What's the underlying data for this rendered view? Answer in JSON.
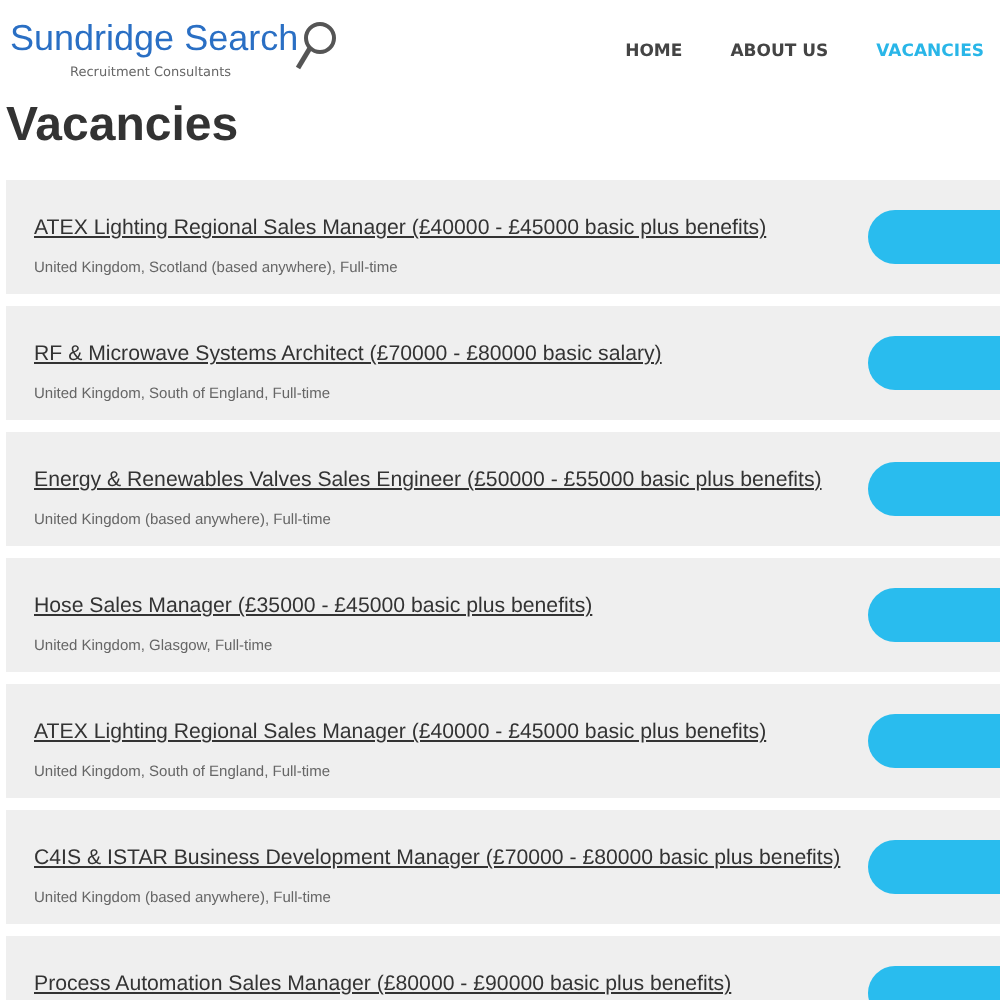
{
  "logo": {
    "name": "Sundridge Search",
    "tagline": "Recruitment Consultants"
  },
  "nav": [
    {
      "label": "HOME",
      "selected": false
    },
    {
      "label": "ABOUT US",
      "selected": false
    },
    {
      "label": "VACANCIES",
      "selected": true
    }
  ],
  "heading": "Vacancies",
  "vacancies": [
    {
      "title": "ATEX Lighting Regional Sales Manager (£40000 - £45000 basic plus benefits)",
      "details": "United Kingdom, Scotland (based anywhere), Full-time"
    },
    {
      "title": "RF & Microwave Systems Architect (£70000 - £80000 basic salary)",
      "details": "United Kingdom, South of England, Full-time"
    },
    {
      "title": "Energy & Renewables Valves Sales Engineer (£50000 - £55000 basic plus benefits)",
      "details": "United Kingdom (based anywhere), Full-time"
    },
    {
      "title": "Hose Sales Manager (£35000 - £45000 basic plus benefits)",
      "details": "United Kingdom, Glasgow, Full-time"
    },
    {
      "title": "ATEX Lighting Regional Sales Manager (£40000 - £45000 basic plus benefits)",
      "details": "United Kingdom, South of England, Full-time"
    },
    {
      "title": "C4IS & ISTAR Business Development Manager (£70000 - £80000 basic plus benefits)",
      "details": "United Kingdom (based anywhere), Full-time"
    },
    {
      "title": "Process Automation Sales Manager (£80000 - £90000 basic plus benefits)"
    }
  ]
}
